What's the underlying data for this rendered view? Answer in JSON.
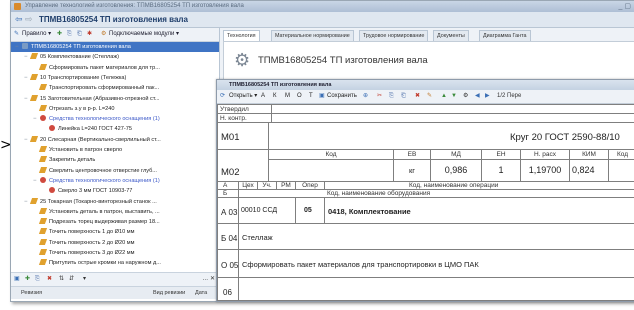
{
  "window": {
    "title": "Управление технологией изготовления: ТПМВ16805254 ТП изготовления вала"
  },
  "navbar": {
    "back_glyph": "⇦",
    "forward_glyph": "⇨",
    "title": "ТПМВ16805254 ТП изготовления вала"
  },
  "left_toolbar": {
    "edit_label": "Правило ▾",
    "modules_label": "Подключаемые модули ▾"
  },
  "tree": [
    {
      "label": "ТПМВ16805254 ТП изготовления вала",
      "indent": 0,
      "icon": "folder",
      "selected": true,
      "expand": "−"
    },
    {
      "label": "05 Комплектование (Стеллаж)",
      "indent": 1,
      "icon": "pen",
      "expand": "−"
    },
    {
      "label": "Сформировать пакет материалов для тр...",
      "indent": 2,
      "icon": "pen"
    },
    {
      "label": "10 Транспортирование (Тележка)",
      "indent": 1,
      "icon": "pen",
      "expand": "−"
    },
    {
      "label": "Транспортировать сформированный пак...",
      "indent": 2,
      "icon": "pen"
    },
    {
      "label": "15 Заготовительная (Абразивно-отрезной ст...",
      "indent": 1,
      "icon": "pen",
      "expand": "−"
    },
    {
      "label": "Отрезать з.у в р-р. L=240",
      "indent": 2,
      "icon": "pen"
    },
    {
      "label": "Средства технологического оснащения (1)",
      "indent": 2,
      "icon": "tool",
      "link": true,
      "expand": "−"
    },
    {
      "label": "Линейка L=240 ГОСТ 427-75",
      "indent": 3,
      "icon": "tool"
    },
    {
      "label": "20 Слесарная (Вертикально-сверлильный ст...",
      "indent": 1,
      "icon": "pen",
      "expand": "−"
    },
    {
      "label": "Установить в патрон сверло",
      "indent": 2,
      "icon": "pen"
    },
    {
      "label": "Закрепить деталь",
      "indent": 2,
      "icon": "pen"
    },
    {
      "label": "Сверлить центровочное отверстие глуб...",
      "indent": 2,
      "icon": "pen"
    },
    {
      "label": "Средства технологического оснащения (1)",
      "indent": 2,
      "icon": "tool",
      "link": true,
      "expand": "−"
    },
    {
      "label": "Сверло 3 мм ГОСТ 10903-77",
      "indent": 3,
      "icon": "tool"
    },
    {
      "label": "25 Токарная (Токарно-винторезный станок ...",
      "indent": 1,
      "icon": "pen",
      "expand": "−"
    },
    {
      "label": "Установить деталь в патрон, выставить, ...",
      "indent": 2,
      "icon": "pen"
    },
    {
      "label": "Подрезать торец выдерживая размер 18...",
      "indent": 2,
      "icon": "pen"
    },
    {
      "label": "Точить поверхность 1 до Ø10 мм",
      "indent": 2,
      "icon": "pen"
    },
    {
      "label": "Точить поверхность 2 до Ø20 мм",
      "indent": 2,
      "icon": "pen"
    },
    {
      "label": "Точить поверхность 3 до Ø22 мм",
      "indent": 2,
      "icon": "pen"
    },
    {
      "label": "Притупить острые кромки на наружном д...",
      "indent": 2,
      "icon": "pen"
    }
  ],
  "left_bottom": {
    "col_revision": "Ревизия",
    "col_kind": "Вид ревизии",
    "col_date": "Дата"
  },
  "tabs": [
    "Технология",
    "Материальное нормирование",
    "Трудовое нормирование",
    "Документы",
    "Диаграмма Ганта"
  ],
  "header": {
    "title": "ТПМВ16805254 ТП изготовления вала"
  },
  "doc": {
    "title": "ТПМВ16805254 ТП изготовления вала",
    "toolbar": {
      "open": "Открыть ▾",
      "letters": [
        "А",
        "К",
        "М",
        "О",
        "Т"
      ],
      "save": "Сохранить",
      "pager": "1/2 Пере"
    },
    "sheet": {
      "approved": "Утвердил",
      "norm_control": "Н. контр.",
      "m01": "М01",
      "m01_value": "Круг 20 ГОСТ 2590-88/10",
      "m02": "М02",
      "head_code": "Код",
      "head_ev": "ЕВ",
      "head_md": "МД",
      "head_en": "ЕН",
      "head_nrash": "Н. расх",
      "head_kim": "КИМ",
      "head_kod2": "Код",
      "unit": "кг",
      "md": "0,986",
      "en": "1",
      "nrash": "1,19700",
      "kim": "0,824",
      "row_a_label": "А",
      "row_b_label": "Б",
      "col_ceh": "Цех",
      "col_uch": "Уч.",
      "col_rm": "РМ",
      "col_oper": "Опер",
      "col_kod_naim_oper": "Код, наименование операции",
      "col_kod_naim_obor": "Код, наименование оборудования",
      "a03": "А 03",
      "a03_code": "00010 ССД",
      "a03_oper": "05",
      "a03_name": "0418, Комплектование",
      "b04": "Б 04",
      "b04_text": "Стеллаж",
      "o05": "О 05",
      "o05_text": "Сформировать пакет материалов для транспортировки в ЦМО ПАК",
      "r06": "06"
    }
  }
}
